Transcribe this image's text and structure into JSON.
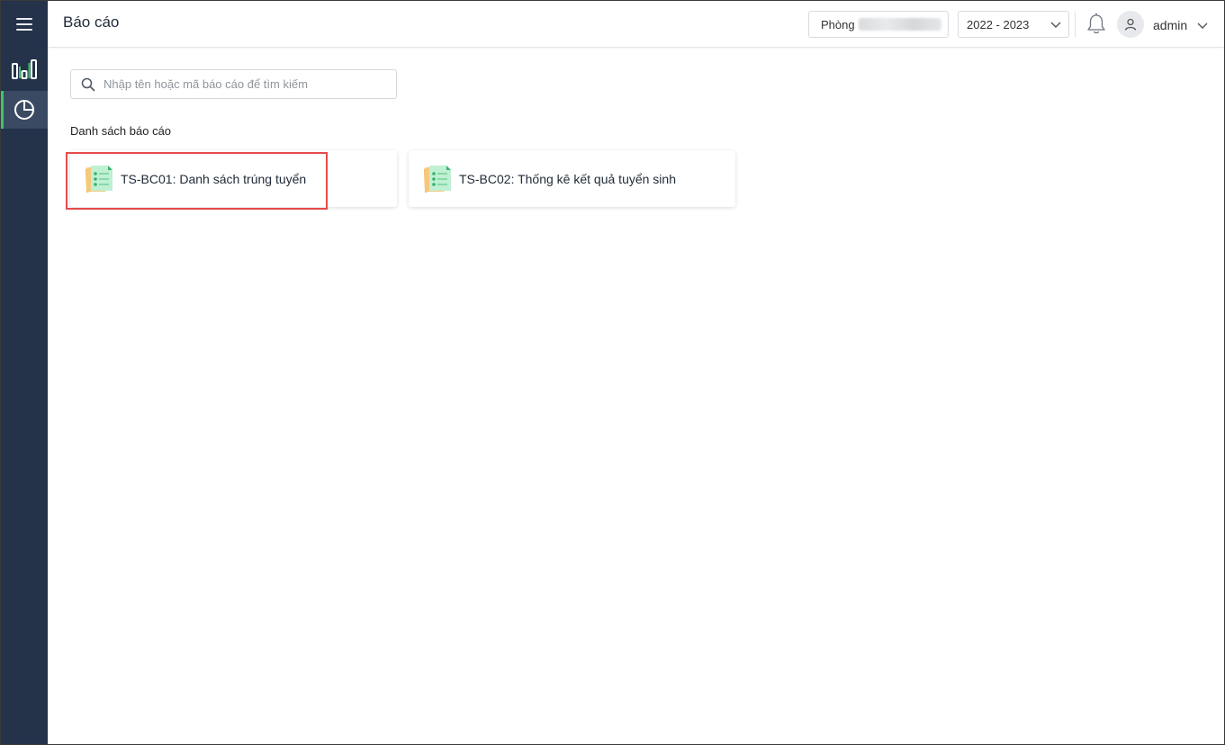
{
  "header": {
    "title": "Báo cáo",
    "department_label": "Phòng",
    "school_year": "2022 - 2023",
    "username": "admin"
  },
  "search": {
    "placeholder": "Nhập tên hoặc mã báo cáo để tìm kiếm",
    "value": ""
  },
  "section_title": "Danh sách báo cáo",
  "reports": [
    {
      "label": "TS-BC01: Danh sách trúng tuyển",
      "icon": "report-checklist-icon"
    },
    {
      "label": "TS-BC02: Thống kê kết quả tuyển sinh",
      "icon": "report-checklist-icon"
    }
  ],
  "colors": {
    "sidebar_bg": "#24324a",
    "sidebar_active_bg": "#3a4a63",
    "accent_green": "#3cc46b",
    "highlight_red": "#e64b4b"
  },
  "icons": {
    "menu": "hamburger-menu-icon",
    "dashboard": "bar-chart-icon",
    "report": "pie-chart-icon",
    "notification": "bell-icon",
    "user": "user-icon",
    "search": "search-icon"
  }
}
